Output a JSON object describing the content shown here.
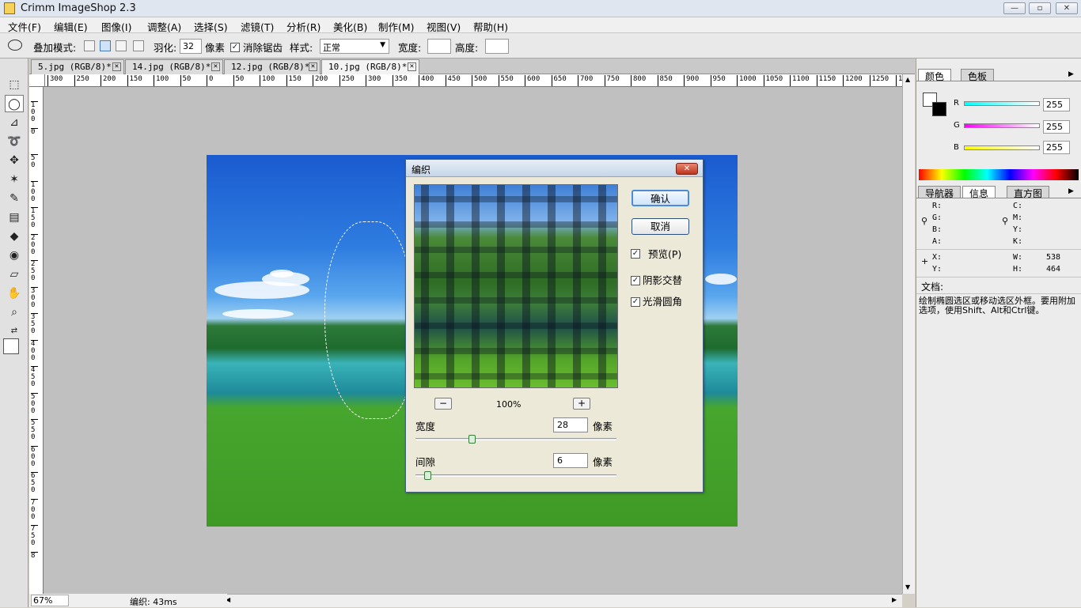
{
  "app": {
    "title": "Crimm ImageShop 2.3",
    "win_min": "—",
    "win_max": "▫",
    "win_close": "✕"
  },
  "menu": [
    "文件(F)",
    "编辑(E)",
    "图像(I)",
    "调整(A)",
    "选择(S)",
    "滤镜(T)",
    "分析(R)",
    "美化(B)",
    "制作(M)",
    "视图(V)",
    "帮助(H)"
  ],
  "options": {
    "blend_label": "叠加模式:",
    "feather_label": "羽化:",
    "feather_value": "32",
    "feather_unit": "像素",
    "antialias_label": "消除锯齿",
    "antialias_checked": true,
    "style_label": "样式:",
    "style_value": "正常",
    "width_label": "宽度:",
    "height_label": "高度:"
  },
  "tabs": [
    {
      "label": "5.jpg (RGB/8)*"
    },
    {
      "label": "14.jpg (RGB/8)*"
    },
    {
      "label": "12.jpg (RGB/8)*"
    },
    {
      "label": "10.jpg (RGB/8)*",
      "active": true
    }
  ],
  "ruler_h": [
    "300",
    "250",
    "200",
    "150",
    "100",
    "50",
    "0",
    "50",
    "100",
    "150",
    "200",
    "250",
    "300",
    "350",
    "400",
    "450",
    "500",
    "550",
    "600",
    "650",
    "700",
    "750",
    "800",
    "850",
    "900",
    "950",
    "1000",
    "1050",
    "1100",
    "1150",
    "1200",
    "1250",
    "13"
  ],
  "ruler_v": [
    "100",
    "0",
    "50",
    "100",
    "150",
    "200",
    "250",
    "300",
    "350",
    "400",
    "450",
    "500",
    "550",
    "600",
    "650",
    "700",
    "750",
    "8"
  ],
  "status": {
    "zoom": "67%",
    "message": "编织: 43ms"
  },
  "color_panel": {
    "tabs": [
      "颜色",
      "色板"
    ],
    "r_label": "R",
    "r_value": "255",
    "g_label": "G",
    "g_value": "255",
    "b_label": "B",
    "b_value": "255"
  },
  "info_panel": {
    "tabs": [
      "导航器",
      "信息",
      "直方图"
    ],
    "rgb_labels": [
      "R:",
      "G:",
      "B:",
      "A:"
    ],
    "cmyk_labels": [
      "C:",
      "M:",
      "Y:",
      "K:"
    ],
    "x_label": "X:",
    "y_label": "Y:",
    "w_label": "W:",
    "w_value": "538",
    "h_label": "H:",
    "h_value": "464",
    "doc_label": "文档:",
    "hint": "绘制椭圆选区或移动选区外框。要用附加选项，使用Shift、Alt和Ctrl键。"
  },
  "dialog": {
    "title": "编织",
    "ok": "确认",
    "cancel": "取消",
    "preview_label": "预览(P)",
    "preview_checked": true,
    "shadow_label": "阴影交替",
    "shadow_checked": true,
    "smooth_label": "光滑圆角",
    "smooth_checked": true,
    "zoom_minus": "−",
    "zoom_plus": "+",
    "zoom_value": "100%",
    "width_label": "宽度",
    "width_value": "28",
    "width_unit": "像素",
    "width_slider_fraction": 0.28,
    "gap_label": "间隙",
    "gap_value": "6",
    "gap_unit": "像素",
    "gap_slider_fraction": 0.06
  }
}
